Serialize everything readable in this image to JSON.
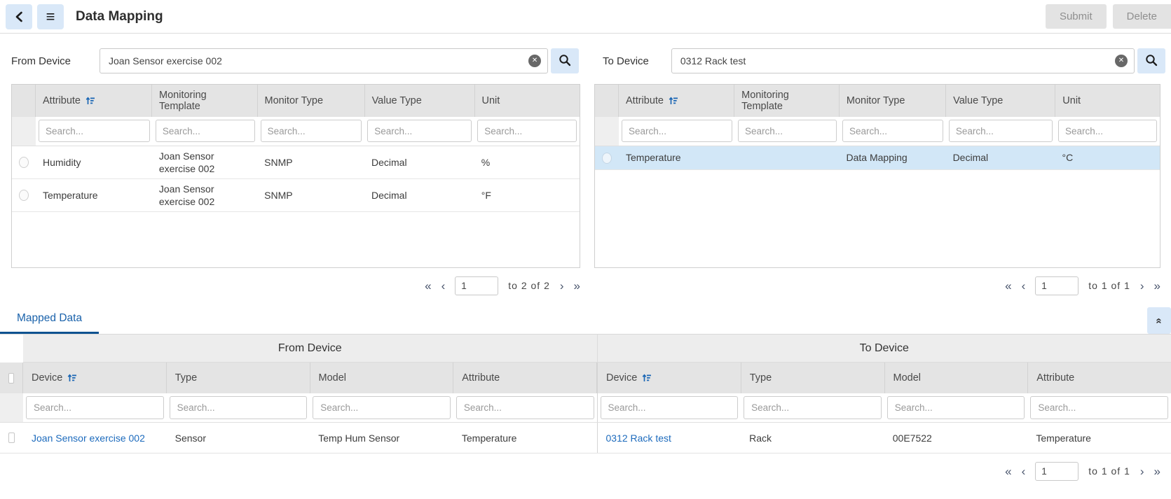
{
  "header": {
    "title": "Data Mapping",
    "submit_label": "Submit",
    "delete_label": "Delete"
  },
  "search": {
    "from": {
      "label": "From Device",
      "value": "Joan Sensor exercise 002"
    },
    "to": {
      "label": "To Device",
      "value": "0312 Rack test"
    },
    "filter_placeholder": "Search..."
  },
  "attribute_columns": {
    "attribute": "Attribute",
    "monitoring_template": "Monitoring Template",
    "monitor_type": "Monitor Type",
    "value_type": "Value Type",
    "unit": "Unit"
  },
  "from_table": {
    "rows": [
      {
        "attribute": "Humidity",
        "monitoring_template": "Joan Sensor exercise 002",
        "monitor_type": "SNMP",
        "value_type": "Decimal",
        "unit": "%"
      },
      {
        "attribute": "Temperature",
        "monitoring_template": "Joan Sensor exercise 002",
        "monitor_type": "SNMP",
        "value_type": "Decimal",
        "unit": "°F"
      }
    ],
    "pagination": {
      "page": "1",
      "range_text": "to  2  of  2"
    }
  },
  "to_table": {
    "rows": [
      {
        "attribute": "Temperature",
        "monitoring_template": "",
        "monitor_type": "Data Mapping",
        "value_type": "Decimal",
        "unit": "°C",
        "selected": true
      }
    ],
    "pagination": {
      "page": "1",
      "range_text": "to  1  of  1"
    }
  },
  "mapped": {
    "tab_label": "Mapped Data",
    "group_headers": {
      "from": "From Device",
      "to": "To Device"
    },
    "columns": {
      "device": "Device",
      "type": "Type",
      "model": "Model",
      "attribute": "Attribute"
    },
    "row": {
      "from": {
        "device": "Joan Sensor exercise 002",
        "type": "Sensor",
        "model": "Temp Hum Sensor",
        "attribute": "Temperature"
      },
      "to": {
        "device": "0312 Rack test",
        "type": "Rack",
        "model": "00E7522",
        "attribute": "Temperature"
      }
    },
    "pagination": {
      "page": "1",
      "range_text": "to  1  of  1"
    }
  },
  "pager_icons": {
    "first": "«",
    "prev": "‹",
    "next": "›",
    "last": "»"
  },
  "icons": {
    "back": "chevron-left",
    "menu": "hamburger",
    "search": "magnifier",
    "clear": "circle-x",
    "sort": "sort-ascending",
    "collapse": "double-chevron-up"
  },
  "colors": {
    "accent_button_bg": "#d9e8f8",
    "link_blue": "#1d6bbd",
    "tab_blue": "#1a62ab",
    "tab_underline": "#0d5290",
    "selected_row_bg": "#d2e7f7",
    "header_gray": "#e4e4e4",
    "disabled_button_bg": "#e3e3e3"
  }
}
